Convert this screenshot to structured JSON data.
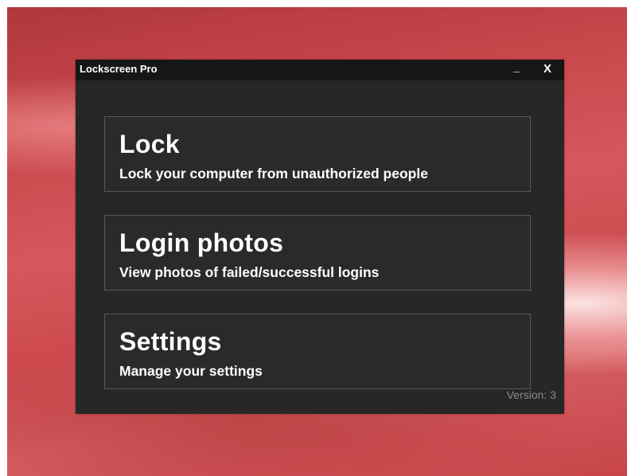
{
  "window": {
    "title": "Lockscreen Pro",
    "minimize_label": "_",
    "close_label": "X"
  },
  "tiles": [
    {
      "title": "Lock",
      "subtitle": "Lock your computer from unauthorized people"
    },
    {
      "title": "Login photos",
      "subtitle": "View photos of failed/successful logins"
    },
    {
      "title": "Settings",
      "subtitle": "Manage your settings"
    }
  ],
  "footer": {
    "version": "Version: 3"
  },
  "colors": {
    "window_bg": "#272727",
    "titlebar_bg": "#161616",
    "tile_border": "#585858",
    "version_text": "#8a8a8a",
    "desktop_accent": "#c9484c"
  }
}
